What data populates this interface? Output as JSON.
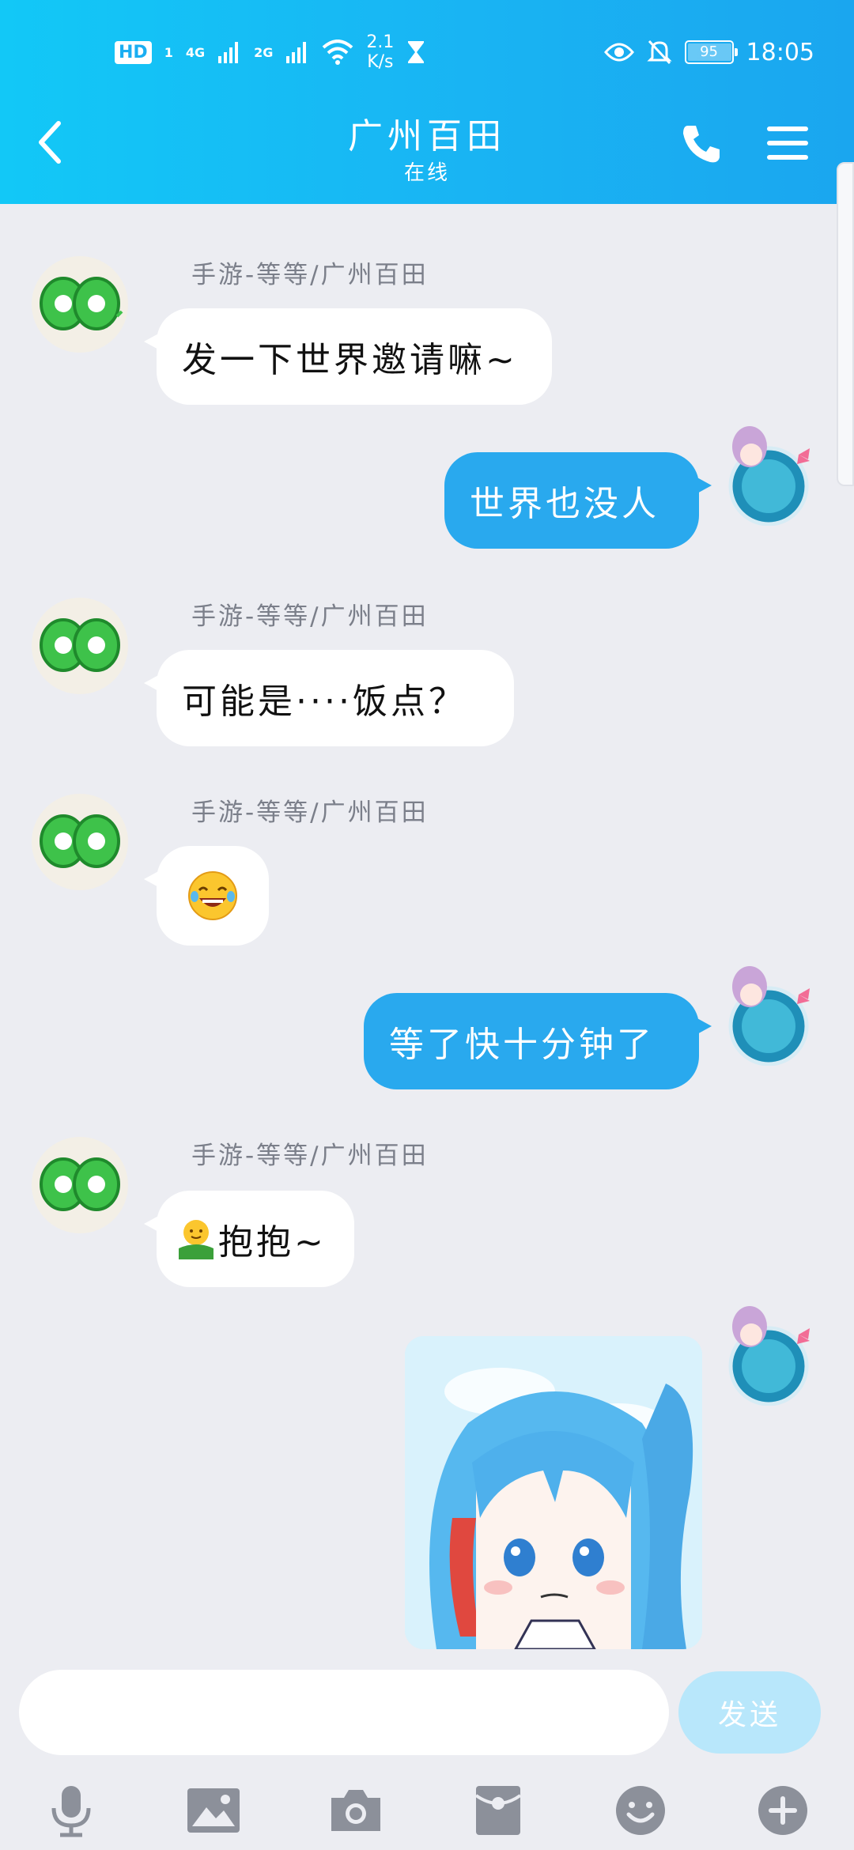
{
  "status_bar": {
    "hd": "HD",
    "sim1": "1",
    "net1": "4G",
    "net2": "2G",
    "speed_value": "2.1",
    "speed_unit": "K/s",
    "battery": "95",
    "time": "18:05"
  },
  "header": {
    "title": "广州百田",
    "subtitle": "在线"
  },
  "messages": [
    {
      "sender": "手游-等等/广州百田",
      "text": "发一下世界邀请嘛~"
    },
    {
      "text": "世界也没人"
    },
    {
      "sender": "手游-等等/广州百田",
      "text": "可能是····饭点？"
    },
    {
      "sender": "手游-等等/广州百田",
      "emoji": "laughing-tears-emoji"
    },
    {
      "text": "等了快十分钟了"
    },
    {
      "sender": "手游-等等/广州百田",
      "text": "抱抱~",
      "emoji": "hug-emoji"
    },
    {
      "image": "anime-girl-sticker"
    }
  ],
  "input": {
    "placeholder": "",
    "send_label": "发送"
  },
  "toolbar_icons": [
    "microphone-icon",
    "image-icon",
    "camera-icon",
    "red-packet-icon",
    "emoji-icon",
    "plus-icon"
  ],
  "colors": {
    "header": "#19b4f3",
    "bubble_out": "#29a9ee",
    "bubble_in": "#ffffff",
    "background": "#ecedf2",
    "send_button": "#b8e7fb"
  }
}
